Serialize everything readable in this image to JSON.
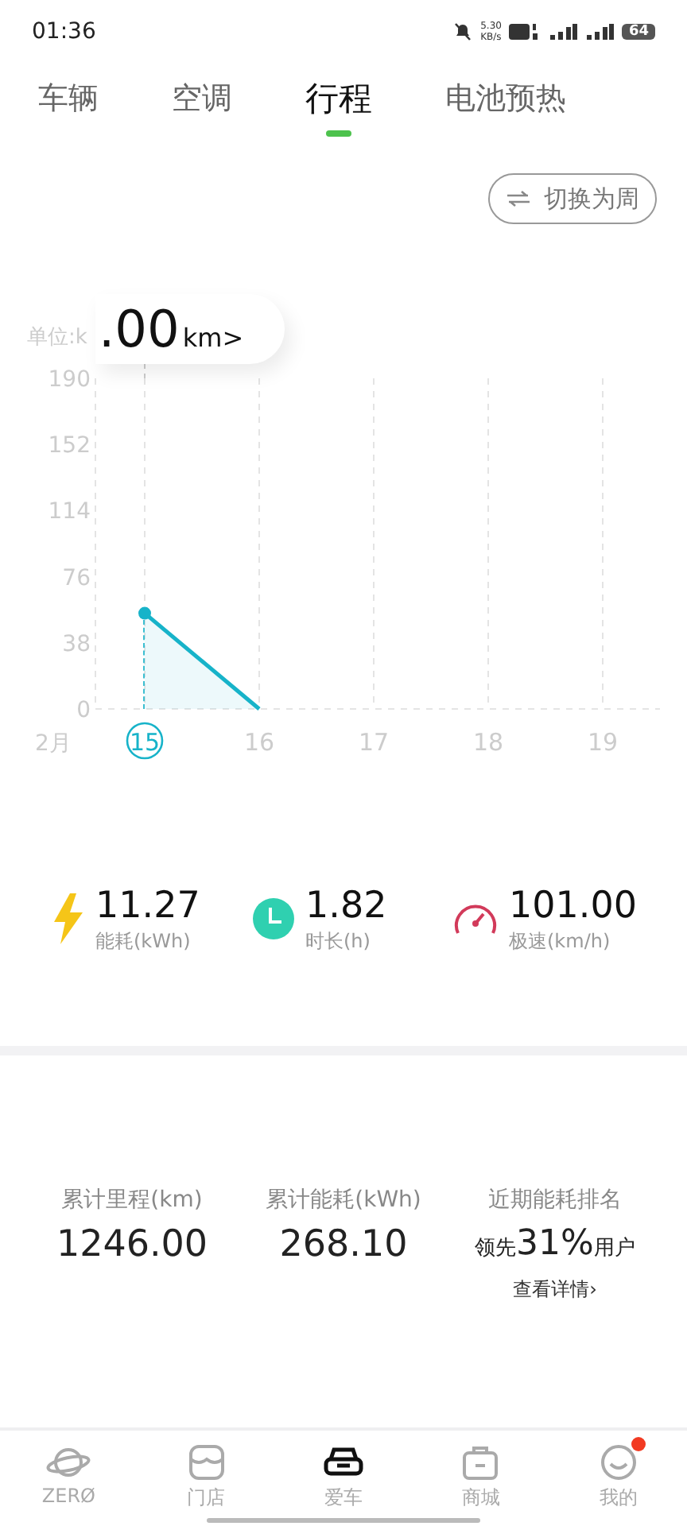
{
  "status_bar": {
    "time": "01:36",
    "net_speed": "5.30",
    "net_unit": "KB/s",
    "battery": "64"
  },
  "tabs": [
    {
      "label": "车辆",
      "selected": false
    },
    {
      "label": "空调",
      "selected": false
    },
    {
      "label": "行程",
      "selected": true
    },
    {
      "label": "电池预热",
      "selected": false
    }
  ],
  "switch_button": {
    "label": "切换为周"
  },
  "chart": {
    "unit_label": "单位:k",
    "tooltip": {
      "value": ".00",
      "unit": "km>"
    },
    "month_label": "2月",
    "dates": [
      {
        "selected": true
      },
      {
        "selected": false
      },
      {
        "selected": false
      },
      {
        "selected": false
      },
      {
        "selected": false
      }
    ],
    "chart_data": {
      "type": "area",
      "categories": [
        "15",
        "16",
        "17",
        "18",
        "19"
      ],
      "grid": true,
      "ref_lines": [
        {
          "axis": "x",
          "value": "15"
        }
      ],
      "series": [
        {
          "color": "#17b3c9",
          "values": [
            55,
            0,
            null,
            null,
            null
          ]
        }
      ],
      "ylim": [
        0,
        190
      ],
      "yticks": [
        0,
        38,
        76,
        114,
        152,
        190
      ]
    }
  },
  "stats": [
    {
      "kind": "energy",
      "value": "11.27",
      "label": "能耗(kWh)"
    },
    {
      "kind": "duration",
      "value": "1.82",
      "label": "时长(h)"
    },
    {
      "kind": "speed",
      "value": "101.00",
      "label": "极速(km/h)"
    }
  ],
  "totals": [
    {
      "label": "累计里程(km)",
      "value": "1246.00"
    },
    {
      "label": "累计能耗(kWh)",
      "value": "268.10"
    }
  ],
  "ranking": {
    "label": "近期能耗排名",
    "prefix": "领先",
    "value": "31%",
    "suffix": "用户",
    "link": "查看详情›"
  },
  "nav": [
    {
      "kind": "planet",
      "label": "ZERØ",
      "selected": false,
      "badge": false
    },
    {
      "kind": "store",
      "label": "门店",
      "selected": false,
      "badge": false
    },
    {
      "kind": "car",
      "label": "爱车",
      "selected": true,
      "badge": false
    },
    {
      "kind": "bag",
      "label": "商城",
      "selected": false,
      "badge": false
    },
    {
      "kind": "smile",
      "label": "我的",
      "selected": false,
      "badge": true
    }
  ]
}
